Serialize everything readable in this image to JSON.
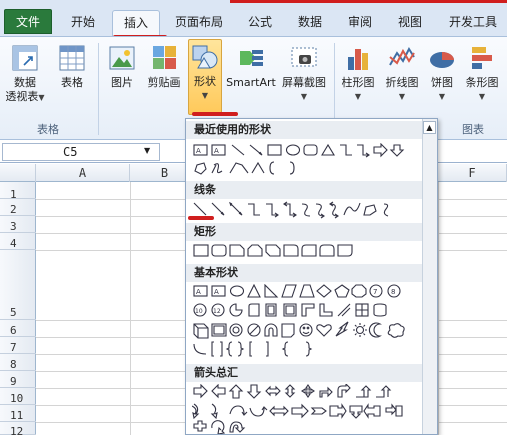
{
  "tabs": {
    "file": "文件",
    "home": "开始",
    "insert": "插入",
    "page_layout": "页面布局",
    "formulas": "公式",
    "data": "数据",
    "review": "审阅",
    "view": "视图",
    "developer": "开发工具"
  },
  "ribbon": {
    "pivot_line1": "数据",
    "pivot_line2": "透视表",
    "table": "表格",
    "group_tables": "表格",
    "picture": "图片",
    "clipart": "剪贴画",
    "shapes": "形状",
    "smartart": "SmartArt",
    "screenshot": "屏幕截图",
    "column_chart": "柱形图",
    "line_chart": "折线图",
    "pie_chart": "饼图",
    "bar_chart": "条形图",
    "group_charts": "图表"
  },
  "formula_bar": {
    "name_box": "C5"
  },
  "columns": [
    "A",
    "B",
    "F"
  ],
  "rows": [
    "1",
    "2",
    "3",
    "4",
    "5",
    "6",
    "7",
    "8",
    "9",
    "10",
    "11",
    "12"
  ],
  "shapes_panel": {
    "recent": "最近使用的形状",
    "lines": "线条",
    "rectangles": "矩形",
    "basic": "基本形状",
    "arrows": "箭头总汇"
  },
  "colors": {
    "accent_red": "#d01e1e",
    "ribbon_blue": "#dbe6f4",
    "file_green": "#2a7a3c"
  }
}
